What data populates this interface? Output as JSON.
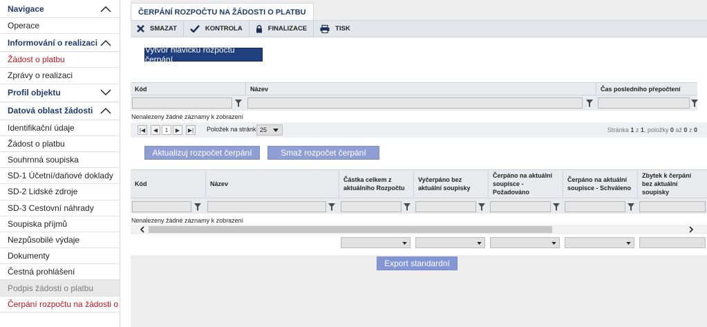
{
  "sidebar": {
    "sections": [
      {
        "label": "Navigace",
        "expanded": true,
        "items": [
          "Operace"
        ]
      },
      {
        "label": "Informování o realizaci",
        "expanded": true,
        "items": [
          "Žádost o platbu",
          "Zprávy o realizaci"
        ]
      },
      {
        "label": "Profil objektu",
        "expanded": false,
        "items": []
      },
      {
        "label": "Datová oblast žádosti",
        "expanded": true,
        "items": [
          "Identifikační údaje",
          "Žádost o platbu",
          "Souhrnná soupiska",
          "SD-1 Účetní/daňové doklady",
          "SD-2 Lidské zdroje",
          "SD-3 Cestovní náhrady",
          "Soupiska příjmů",
          "Nezpůsobilé výdaje",
          "Dokumenty",
          "Čestná prohlášení",
          "Podpis žádosti o platbu",
          "Čerpání rozpočtu na žádosti o platbu"
        ]
      }
    ]
  },
  "tab": {
    "title": "ČERPÁNÍ ROZPOČTU NA ŽÁDOSTI O PLATBU"
  },
  "toolbar": {
    "delete": "SMAZAT",
    "check": "KONTROLA",
    "finalize": "FINALIZACE",
    "print": "TISK"
  },
  "create_header_button": "Vytvoř hlavičku rozpočtu čerpání",
  "grid1": {
    "columns": [
      "Kód",
      "Název",
      "Čas posledního přepočtení"
    ],
    "no_records": "Nenalezeny žádné záznamy k zobrazení",
    "pager": {
      "page": "1",
      "per_page_label": "Položek na stránku",
      "per_page": "25",
      "status_prefix": "Stránka ",
      "page_num": "1",
      "status_mid1": " z ",
      "page_total": "1",
      "status_mid2": ", položky ",
      "from": "0",
      "status_mid3": " až ",
      "to": "0",
      "status_mid4": " z ",
      "total": "0"
    }
  },
  "update_button": "Aktualizuj rozpočet čerpání",
  "delete_budget_button": "Smaž rozpočet čerpání",
  "grid2": {
    "columns": [
      "Kód",
      "Název",
      "Částka celkem z aktuálního Rozpočtu",
      "Vyčerpáno bez aktuální soupisky",
      "Čerpáno na aktuální soupisce - Požadováno",
      "Čerpáno na aktuální soupisce - Schváleno",
      "Zbytek k čerpání bez aktuální soupisky"
    ],
    "no_records": "Nenalezeny žádné záznamy k zobrazení"
  },
  "export_button": "Export standardní",
  "colors": {
    "nav_text": "#1f3a6e",
    "active_red": "#c0141c",
    "primary_btn": "#1f3f7e",
    "light_btn": "#8f9fd4"
  }
}
